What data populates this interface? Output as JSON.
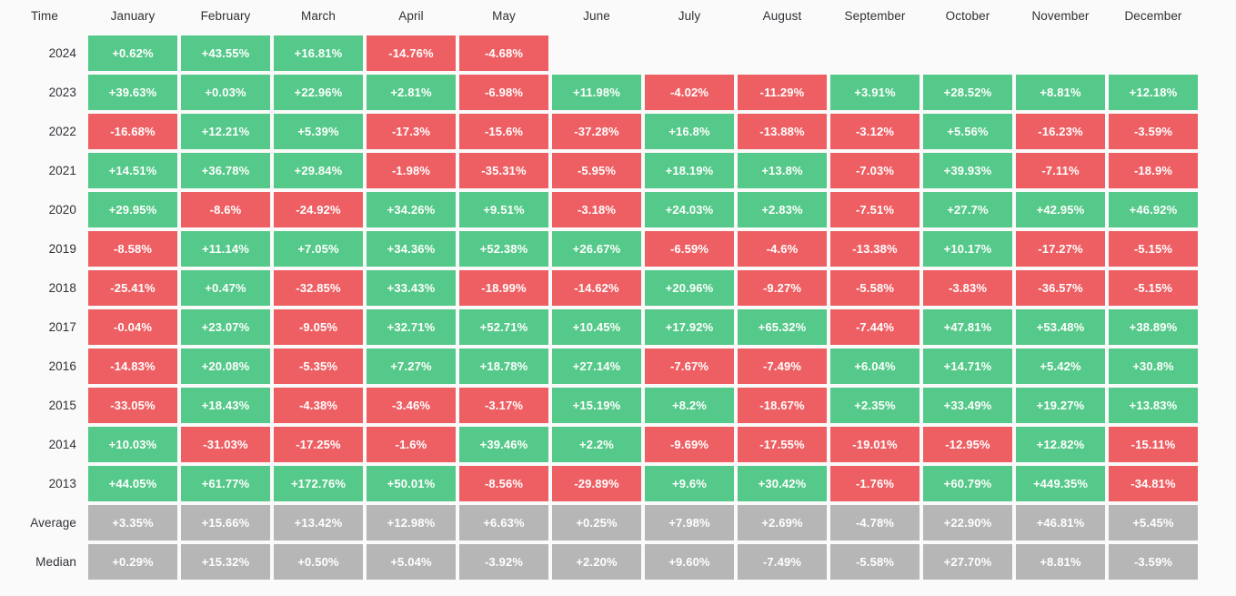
{
  "table": {
    "corner_label": "Time",
    "columns": [
      "January",
      "February",
      "March",
      "April",
      "May",
      "June",
      "July",
      "August",
      "September",
      "October",
      "November",
      "December"
    ],
    "colors": {
      "positive": "#55c989",
      "negative": "#ee5f63",
      "stat": "#b6b6b6",
      "background": "#fafafa",
      "text": "#ffffff",
      "header_text": "#2f3136"
    },
    "rows": [
      {
        "label": "2024",
        "kind": "year",
        "cells": [
          "+0.62%",
          "+43.55%",
          "+16.81%",
          "-14.76%",
          "-4.68%",
          "",
          "",
          "",
          "",
          "",
          "",
          ""
        ]
      },
      {
        "label": "2023",
        "kind": "year",
        "cells": [
          "+39.63%",
          "+0.03%",
          "+22.96%",
          "+2.81%",
          "-6.98%",
          "+11.98%",
          "-4.02%",
          "-11.29%",
          "+3.91%",
          "+28.52%",
          "+8.81%",
          "+12.18%"
        ]
      },
      {
        "label": "2022",
        "kind": "year",
        "cells": [
          "-16.68%",
          "+12.21%",
          "+5.39%",
          "-17.3%",
          "-15.6%",
          "-37.28%",
          "+16.8%",
          "-13.88%",
          "-3.12%",
          "+5.56%",
          "-16.23%",
          "-3.59%"
        ]
      },
      {
        "label": "2021",
        "kind": "year",
        "cells": [
          "+14.51%",
          "+36.78%",
          "+29.84%",
          "-1.98%",
          "-35.31%",
          "-5.95%",
          "+18.19%",
          "+13.8%",
          "-7.03%",
          "+39.93%",
          "-7.11%",
          "-18.9%"
        ]
      },
      {
        "label": "2020",
        "kind": "year",
        "cells": [
          "+29.95%",
          "-8.6%",
          "-24.92%",
          "+34.26%",
          "+9.51%",
          "-3.18%",
          "+24.03%",
          "+2.83%",
          "-7.51%",
          "+27.7%",
          "+42.95%",
          "+46.92%"
        ]
      },
      {
        "label": "2019",
        "kind": "year",
        "cells": [
          "-8.58%",
          "+11.14%",
          "+7.05%",
          "+34.36%",
          "+52.38%",
          "+26.67%",
          "-6.59%",
          "-4.6%",
          "-13.38%",
          "+10.17%",
          "-17.27%",
          "-5.15%"
        ]
      },
      {
        "label": "2018",
        "kind": "year",
        "cells": [
          "-25.41%",
          "+0.47%",
          "-32.85%",
          "+33.43%",
          "-18.99%",
          "-14.62%",
          "+20.96%",
          "-9.27%",
          "-5.58%",
          "-3.83%",
          "-36.57%",
          "-5.15%"
        ]
      },
      {
        "label": "2017",
        "kind": "year",
        "cells": [
          "-0.04%",
          "+23.07%",
          "-9.05%",
          "+32.71%",
          "+52.71%",
          "+10.45%",
          "+17.92%",
          "+65.32%",
          "-7.44%",
          "+47.81%",
          "+53.48%",
          "+38.89%"
        ]
      },
      {
        "label": "2016",
        "kind": "year",
        "cells": [
          "-14.83%",
          "+20.08%",
          "-5.35%",
          "+7.27%",
          "+18.78%",
          "+27.14%",
          "-7.67%",
          "-7.49%",
          "+6.04%",
          "+14.71%",
          "+5.42%",
          "+30.8%"
        ]
      },
      {
        "label": "2015",
        "kind": "year",
        "cells": [
          "-33.05%",
          "+18.43%",
          "-4.38%",
          "-3.46%",
          "-3.17%",
          "+15.19%",
          "+8.2%",
          "-18.67%",
          "+2.35%",
          "+33.49%",
          "+19.27%",
          "+13.83%"
        ]
      },
      {
        "label": "2014",
        "kind": "year",
        "cells": [
          "+10.03%",
          "-31.03%",
          "-17.25%",
          "-1.6%",
          "+39.46%",
          "+2.2%",
          "-9.69%",
          "-17.55%",
          "-19.01%",
          "-12.95%",
          "+12.82%",
          "-15.11%"
        ]
      },
      {
        "label": "2013",
        "kind": "year",
        "cells": [
          "+44.05%",
          "+61.77%",
          "+172.76%",
          "+50.01%",
          "-8.56%",
          "-29.89%",
          "+9.6%",
          "+30.42%",
          "-1.76%",
          "+60.79%",
          "+449.35%",
          "-34.81%"
        ]
      },
      {
        "label": "Average",
        "kind": "stat",
        "cells": [
          "+3.35%",
          "+15.66%",
          "+13.42%",
          "+12.98%",
          "+6.63%",
          "+0.25%",
          "+7.98%",
          "+2.69%",
          "-4.78%",
          "+22.90%",
          "+46.81%",
          "+5.45%"
        ]
      },
      {
        "label": "Median",
        "kind": "stat",
        "cells": [
          "+0.29%",
          "+15.32%",
          "+0.50%",
          "+5.04%",
          "-3.92%",
          "+2.20%",
          "+9.60%",
          "-7.49%",
          "-5.58%",
          "+27.70%",
          "+8.81%",
          "-3.59%"
        ]
      }
    ]
  }
}
